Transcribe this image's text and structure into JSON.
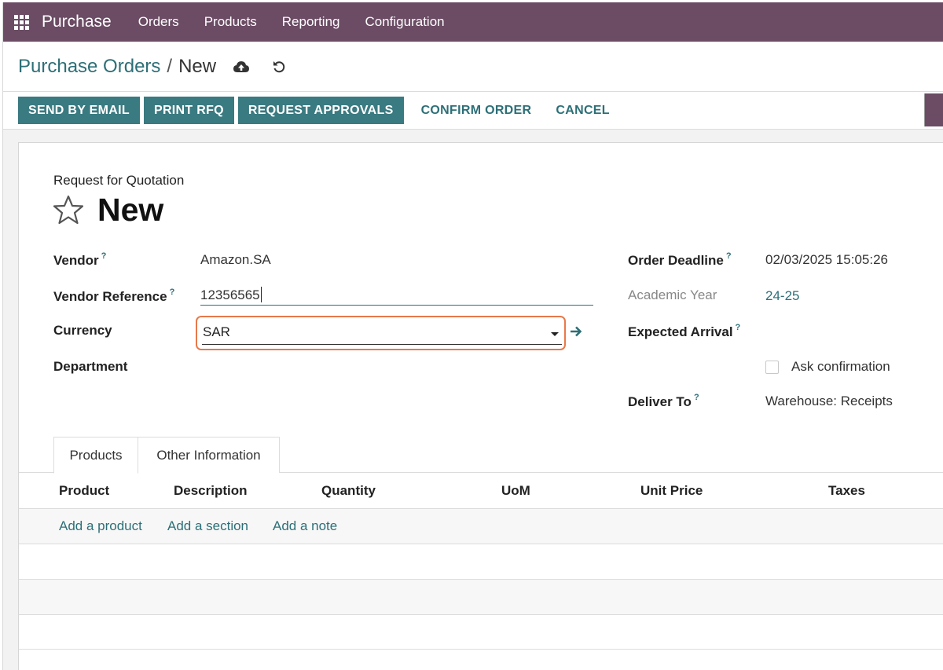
{
  "navbar": {
    "app_name": "Purchase",
    "menu": [
      "Orders",
      "Products",
      "Reporting",
      "Configuration"
    ],
    "apps_icon": "grid-icon",
    "color": "#6b4c64"
  },
  "breadcrumb": {
    "parent": "Purchase Orders",
    "separator": "/",
    "current": "New",
    "save_icon": "cloud-upload-icon",
    "discard_icon": "undo-icon"
  },
  "toolbar": {
    "send_by_email": "SEND BY EMAIL",
    "print_rfq": "PRINT RFQ",
    "request_approvals": "REQUEST APPROVALS",
    "confirm_order": "CONFIRM ORDER",
    "cancel": "CANCEL",
    "accent": "#3a7a81"
  },
  "form": {
    "doc_type": "Request for Quotation",
    "doc_name": "New",
    "star_icon": "star-outline-icon",
    "left": {
      "vendor_label": "Vendor",
      "vendor_value": "Amazon.SA",
      "vendor_ref_label": "Vendor Reference",
      "vendor_ref_value": "12356565",
      "currency_label": "Currency",
      "currency_value": "SAR",
      "department_label": "Department",
      "help_mark": "?"
    },
    "right": {
      "order_deadline_label": "Order Deadline",
      "order_deadline_value": "02/03/2025 15:05:26",
      "academic_year_label": "Academic Year",
      "academic_year_value": "24-25",
      "expected_arrival_label": "Expected Arrival",
      "ask_confirmation_label": "Ask confirmation",
      "ask_confirmation_checked": false,
      "deliver_to_label": "Deliver To",
      "deliver_to_value": "Warehouse: Receipts"
    }
  },
  "tabs": [
    "Products",
    "Other Information"
  ],
  "table": {
    "columns": [
      "Product",
      "Description",
      "Quantity",
      "UoM",
      "Unit Price",
      "Taxes"
    ],
    "add_links": [
      "Add a product",
      "Add a section",
      "Add a note"
    ]
  }
}
